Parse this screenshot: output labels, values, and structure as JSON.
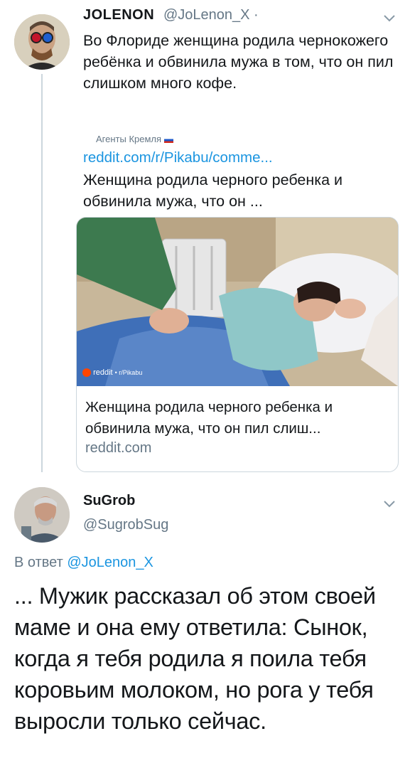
{
  "tweet1": {
    "name": "JOLENON",
    "handle": "@JoLenon_X ·",
    "text": "Во Флориде женщина родила чернокожего ребёнка и обвинила мужа в том, что он пил слишком много кофе.",
    "source_tag": "Агенты Кремля",
    "link_url": "reddit.com/r/Pikabu/comme...",
    "link_description": "Женщина родила черного ребенка и обвинила мужа, что он ...",
    "card": {
      "badge_site": "reddit",
      "badge_sub": "• r/Pikabu",
      "title": "Женщина родила черного ребенка и обвинила мужа, что он пил слиш...",
      "domain": "reddit.com"
    }
  },
  "tweet2": {
    "name": "SuGrob",
    "handle": "@SugrobSug",
    "reply_prefix": "В ответ",
    "reply_handle": "@JoLenon_X",
    "text": "... Мужик рассказал об этом своей маме и она ему ответила: Сынок, когда я тебя родила я поила тебя коровьим молоком, но рога у тебя выросли только сейчас."
  },
  "icons": [
    "chevron-down-icon",
    "reddit-icon"
  ],
  "colors": {
    "link": "#1b95e0",
    "secondary": "#657786",
    "border": "#ccd6dd"
  }
}
